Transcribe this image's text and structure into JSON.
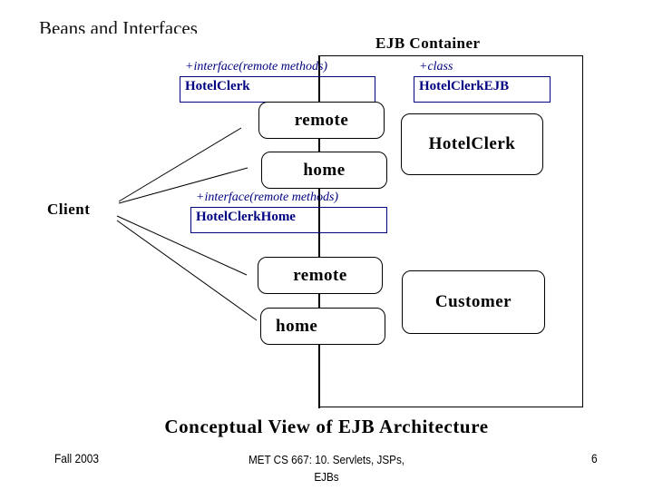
{
  "slide": {
    "title": "Beans and Interfaces",
    "caption": "Conceptual View of EJB Architecture"
  },
  "diagram": {
    "container_title": "EJB Container",
    "client_label": "Client",
    "remote_interface": {
      "stereotype": "+interface(remote methods)",
      "name": "HotelClerk"
    },
    "bean_class": {
      "stereotype": "+class",
      "name": "HotelClerkEJB"
    },
    "home_interface": {
      "stereotype": "+interface(remote methods)",
      "name": "HotelClerkHome"
    },
    "beans": [
      {
        "name": "HotelClerk",
        "remote_label": "remote",
        "home_label": "home"
      },
      {
        "name": "Customer",
        "remote_label": "remote",
        "home_label": "home"
      }
    ],
    "colors": {
      "annotation": "#000080",
      "lines": "#000000"
    }
  },
  "footer": {
    "left": "Fall 2003",
    "center_line1": "MET CS 667: 10. Servlets, JSPs,",
    "center_line2": "EJBs",
    "page_number": "6"
  }
}
